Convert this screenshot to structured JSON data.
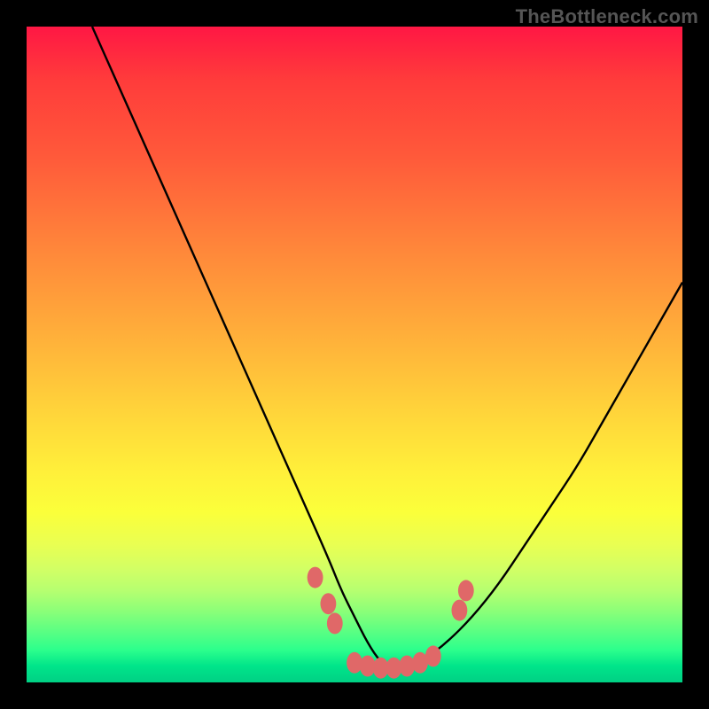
{
  "watermark": {
    "text": "TheBottleneck.com",
    "font_size_px": 22
  },
  "chart_data": {
    "type": "line",
    "title": "",
    "xlabel": "",
    "ylabel": "",
    "xlim": [
      0,
      100
    ],
    "ylim": [
      0,
      100
    ],
    "grid": false,
    "legend": false,
    "background_gradient": {
      "direction": "vertical",
      "stops": [
        {
          "pct": 0,
          "color": "#ff1744"
        },
        {
          "pct": 50,
          "color": "#ffc53a"
        },
        {
          "pct": 75,
          "color": "#fff03a"
        },
        {
          "pct": 100,
          "color": "#00d084"
        }
      ]
    },
    "series": [
      {
        "name": "bottleneck-curve",
        "color": "#000000",
        "x": [
          10,
          14,
          18,
          22,
          26,
          30,
          34,
          38,
          42,
          46,
          48,
          50,
          52,
          54,
          56,
          58,
          60,
          64,
          68,
          72,
          76,
          80,
          84,
          88,
          92,
          96,
          100
        ],
        "y": [
          100,
          91,
          82,
          73,
          64,
          55,
          46,
          37,
          28,
          19,
          14,
          10,
          6,
          3,
          2,
          2,
          3,
          6,
          10,
          15,
          21,
          27,
          33,
          40,
          47,
          54,
          61
        ]
      }
    ],
    "markers": {
      "name": "highlight-dots",
      "color": "#e06868",
      "radius_pct": 1.2,
      "points": [
        {
          "x": 44,
          "y": 16
        },
        {
          "x": 46,
          "y": 12
        },
        {
          "x": 47,
          "y": 9
        },
        {
          "x": 50,
          "y": 3
        },
        {
          "x": 52,
          "y": 2.5
        },
        {
          "x": 54,
          "y": 2.2
        },
        {
          "x": 56,
          "y": 2.2
        },
        {
          "x": 58,
          "y": 2.5
        },
        {
          "x": 60,
          "y": 3
        },
        {
          "x": 62,
          "y": 4
        },
        {
          "x": 66,
          "y": 11
        },
        {
          "x": 67,
          "y": 14
        }
      ]
    }
  }
}
